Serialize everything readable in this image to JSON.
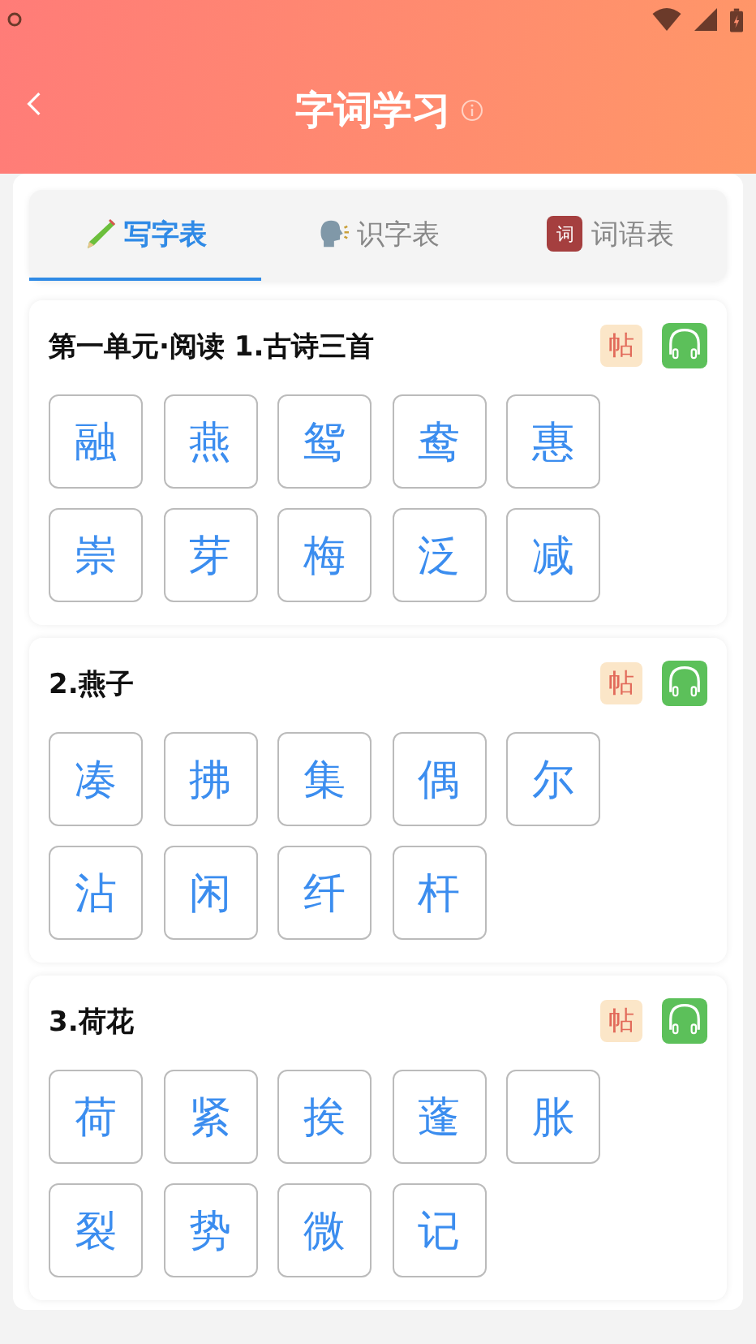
{
  "header": {
    "title": "字词学习"
  },
  "tabs": [
    {
      "label": "写字表",
      "kind": "pencil",
      "selected": true
    },
    {
      "label": "识字表",
      "kind": "speaker",
      "selected": false
    },
    {
      "label": "词语表",
      "kind": "word",
      "icon_text": "词",
      "selected": false
    }
  ],
  "lessons": [
    {
      "title": "第一单元·阅读 1.古诗三首",
      "badge": "帖",
      "characters": [
        "融",
        "燕",
        "鸳",
        "鸯",
        "惠",
        "崇",
        "芽",
        "梅",
        "泛",
        "减"
      ]
    },
    {
      "title": "2.燕子",
      "badge": "帖",
      "characters": [
        "凑",
        "拂",
        "集",
        "偶",
        "尔",
        "沾",
        "闲",
        "纤",
        "杆"
      ]
    },
    {
      "title": "3.荷花",
      "badge": "帖",
      "characters": [
        "荷",
        "紧",
        "挨",
        "蓬",
        "胀",
        "裂",
        "势",
        "微",
        "记"
      ]
    }
  ]
}
